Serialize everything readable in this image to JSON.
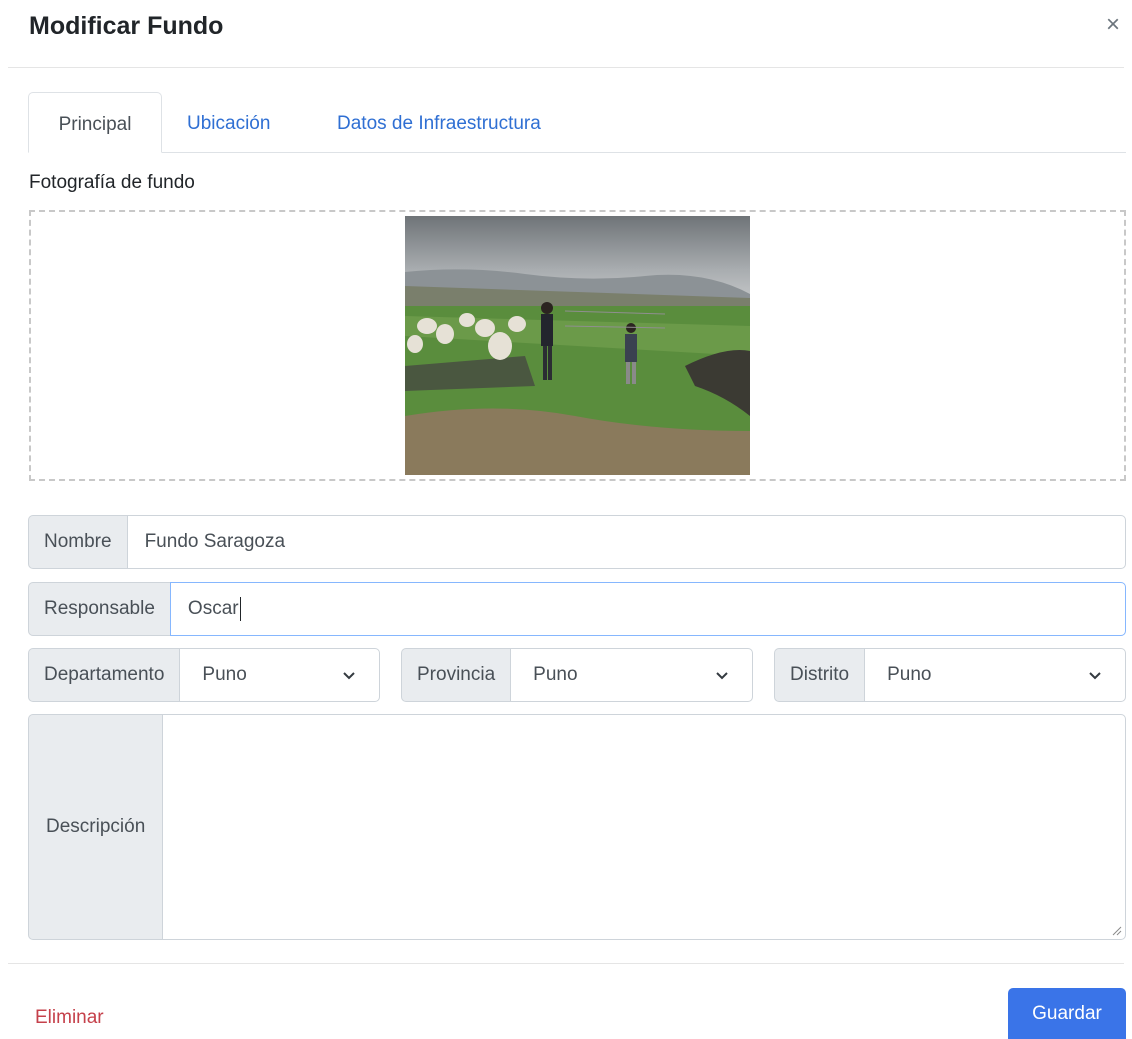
{
  "modal": {
    "title": "Modificar Fundo",
    "close_icon": "×"
  },
  "tabs": [
    {
      "label": "Principal",
      "active": true
    },
    {
      "label": "Ubicación",
      "active": false
    },
    {
      "label": "Datos de Infraestructura",
      "active": false
    }
  ],
  "photo": {
    "label": "Fotografía de fundo"
  },
  "form": {
    "nombre": {
      "label": "Nombre",
      "value": "Fundo Saragoza"
    },
    "responsable": {
      "label": "Responsable",
      "value": "Oscar"
    },
    "departamento": {
      "label": "Departamento",
      "value": "Puno"
    },
    "provincia": {
      "label": "Provincia",
      "value": "Puno"
    },
    "distrito": {
      "label": "Distrito",
      "value": "Puno"
    },
    "descripcion": {
      "label": "Descripción",
      "value": ""
    }
  },
  "footer": {
    "delete_label": "Eliminar",
    "save_label": "Guardar"
  },
  "colors": {
    "accent": "#3a74e8",
    "link": "#2f6fd3",
    "danger": "#c5414b",
    "label_bg": "#e9ecef"
  }
}
